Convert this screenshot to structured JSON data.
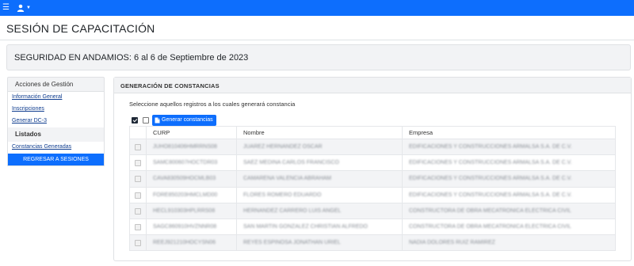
{
  "colors": {
    "primary": "#0d6efd",
    "header_bg": "#f2f3f5",
    "border": "#dfe1e4"
  },
  "topbar": {
    "menu_icon": "hamburger-icon",
    "user_icon": "user-icon",
    "caret_icon": "caret-down-icon"
  },
  "page": {
    "title": "SESIÓN DE CAPACITACIÓN",
    "course_heading": "SEGURIDAD EN ANDAMIOS: 6 al 6 de Septiembre de 2023"
  },
  "sidebar": {
    "header": "Acciones de Gestión",
    "links": [
      "Información General",
      "Inscripciones",
      "Generar DC-3"
    ],
    "section_title": "Listados",
    "section_links": [
      "Constancias Generadas"
    ],
    "return_button": "REGRESAR A SESIONES"
  },
  "main": {
    "header": "GENERACIÓN DE CONSTANCIAS",
    "instructions": "Seleccione aquellos registros a los cuales generará constancia",
    "generate_button": "Generar constancias",
    "generate_icon": "document-icon",
    "columns": [
      "CURP",
      "Nombre",
      "Empresa"
    ],
    "rows": [
      {
        "curp": "JUHO810406HMRRNS08",
        "nombre": "JUAREZ HERNANDEZ OSCAR",
        "empresa": "EDIFICACIONES Y CONSTRUCCIONES ARMALSA S.A. DE C.V."
      },
      {
        "curp": "SAMC800607HOCTDR03",
        "nombre": "SAEZ MEDINA CARLOS FRANCISCO",
        "empresa": "EDIFICACIONES Y CONSTRUCCIONES ARMALSA S.A. DE C.V."
      },
      {
        "curp": "CAVA830509HOCMLB03",
        "nombre": "CAMARENA VALENCIA ABRAHAM",
        "empresa": "EDIFICACIONES Y CONSTRUCCIONES ARMALSA S.A. DE C.V."
      },
      {
        "curp": "FORE850203HMCLMD00",
        "nombre": "FLORES ROMERO EDUARDO",
        "empresa": "EDIFICACIONES Y CONSTRUCCIONES ARMALSA S.A. DE C.V."
      },
      {
        "curp": "HECL910303HPLRRS08",
        "nombre": "HERNANDEZ CARRERO LUIS ANGEL",
        "empresa": "CONSTRUCTORA DE OBRA MECATRONICA ELECTRICA CIVIL"
      },
      {
        "curp": "SAGC860910HVZNNR08",
        "nombre": "SAN MARTIN GONZALEZ CHRISTIAN ALFREDO",
        "empresa": "CONSTRUCTORA DE OBRA MECATRONICA ELECTRICA CIVIL"
      },
      {
        "curp": "REEJ921210HOCYSN06",
        "nombre": "REYES ESPINOSA JONATHAN URIEL",
        "empresa": "NADIA DOLORES RUIZ RAMIREZ"
      }
    ]
  }
}
